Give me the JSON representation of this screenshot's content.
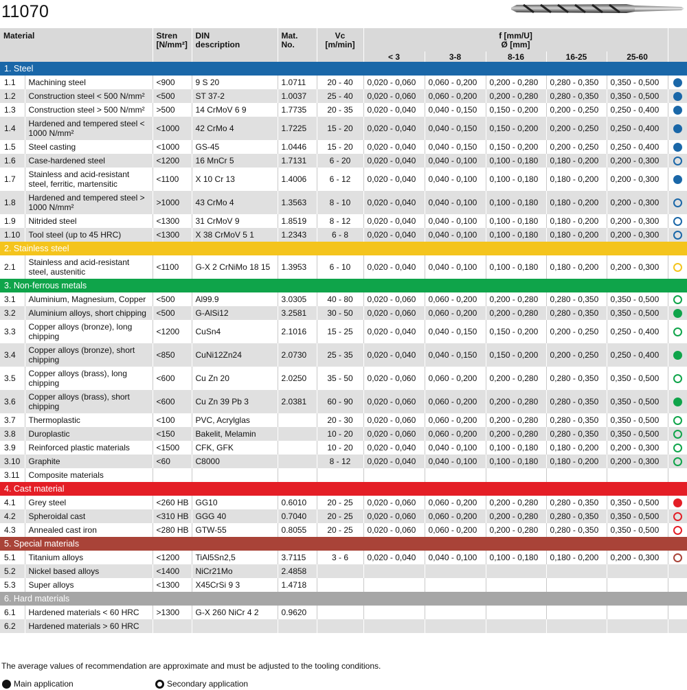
{
  "title": "11070",
  "colors": {
    "steel": "#1a67a8",
    "stainless": "#f4c41d",
    "nonferrous": "#0fa44a",
    "cast": "#e41e26",
    "special": "#a94338",
    "hard": "#a6a6a6",
    "hardmetal": "#8b8b8b"
  },
  "header": {
    "material": "Material",
    "strength_l1": "Stren",
    "strength_l2": "[N/mm²]",
    "din_l1": "DIN",
    "din_l2": "description",
    "matno_l1": "Mat.",
    "matno_l2": "No.",
    "vc_l1": "Vc",
    "vc_l2": "[m/min]",
    "f_l1": "f [mm/U]",
    "f_l2": "Ø [mm]",
    "diameters": [
      "< 3",
      "3-8",
      "8-16",
      "16-25",
      "25-60"
    ]
  },
  "sections": [
    {
      "label": "1. Steel",
      "color": "steel",
      "rows": [
        {
          "no": "1.1",
          "material": "Machining steel",
          "strength": "<900",
          "din": "9 S 20",
          "matno": "1.0711",
          "vc": "20 - 40",
          "f": [
            "0,020 - 0,060",
            "0,060 - 0,200",
            "0,200 - 0,280",
            "0,280 - 0,350",
            "0,350 - 0,500"
          ],
          "app": "main"
        },
        {
          "no": "1.2",
          "material": "Construction steel < 500 N/mm²",
          "strength": "<500",
          "din": "ST 37-2",
          "matno": "1.0037",
          "vc": "25 - 40",
          "f": [
            "0,020 - 0,060",
            "0,060 - 0,200",
            "0,200 - 0,280",
            "0,280 - 0,350",
            "0,350 - 0,500"
          ],
          "app": "main"
        },
        {
          "no": "1.3",
          "material": "Construction steel > 500 N/mm²",
          "strength": ">500",
          "din": "14 CrMoV 6 9",
          "matno": "1.7735",
          "vc": "20 - 35",
          "f": [
            "0,020 - 0,040",
            "0,040 - 0,150",
            "0,150 - 0,200",
            "0,200 - 0,250",
            "0,250 - 0,400"
          ],
          "app": "main"
        },
        {
          "no": "1.4",
          "material": "Hardened and tempered steel < 1000 N/mm²",
          "strength": "<1000",
          "din": "42 CrMo 4",
          "matno": "1.7225",
          "vc": "15 - 20",
          "f": [
            "0,020 - 0,040",
            "0,040 - 0,150",
            "0,150 - 0,200",
            "0,200 - 0,250",
            "0,250 - 0,400"
          ],
          "app": "main",
          "tall": true
        },
        {
          "no": "1.5",
          "material": "Steel casting",
          "strength": "<1000",
          "din": "GS-45",
          "matno": "1.0446",
          "vc": "15 - 20",
          "f": [
            "0,020 - 0,040",
            "0,040 - 0,150",
            "0,150 - 0,200",
            "0,200 - 0,250",
            "0,250 - 0,400"
          ],
          "app": "main"
        },
        {
          "no": "1.6",
          "material": "Case-hardened steel",
          "strength": "<1200",
          "din": "16 MnCr 5",
          "matno": "1.7131",
          "vc": "6 - 20",
          "f": [
            "0,020 - 0,040",
            "0,040 - 0,100",
            "0,100 - 0,180",
            "0,180 - 0,200",
            "0,200 - 0,300"
          ],
          "app": "secondary"
        },
        {
          "no": "1.7",
          "material": "Stainless and acid-resistant steel, ferritic, martensitic",
          "strength": "<1100",
          "din": "X 10 Cr 13",
          "matno": "1.4006",
          "vc": "6 - 12",
          "f": [
            "0,020 - 0,040",
            "0,040 - 0,100",
            "0,100 - 0,180",
            "0,180 - 0,200",
            "0,200 - 0,300"
          ],
          "app": "main",
          "tall": true
        },
        {
          "no": "1.8",
          "material": "Hardened and tempered steel > 1000 N/mm²",
          "strength": ">1000",
          "din": "43 CrMo 4",
          "matno": "1.3563",
          "vc": "8 - 10",
          "f": [
            "0,020 - 0,040",
            "0,040 - 0,100",
            "0,100 - 0,180",
            "0,180 - 0,200",
            "0,200 - 0,300"
          ],
          "app": "secondary",
          "tall": true
        },
        {
          "no": "1.9",
          "material": "Nitrided steel",
          "strength": "<1300",
          "din": "31 CrMoV 9",
          "matno": "1.8519",
          "vc": "8 - 12",
          "f": [
            "0,020 - 0,040",
            "0,040 - 0,100",
            "0,100 - 0,180",
            "0,180 - 0,200",
            "0,200 - 0,300"
          ],
          "app": "secondary"
        },
        {
          "no": "1.10",
          "material": "Tool steel (up to 45 HRC)",
          "strength": "<1300",
          "din": "X 38 CrMoV 5 1",
          "matno": "1.2343",
          "vc": "6 - 8",
          "f": [
            "0,020 - 0,040",
            "0,040 - 0,100",
            "0,100 - 0,180",
            "0,180 - 0,200",
            "0,200 - 0,300"
          ],
          "app": "secondary"
        }
      ]
    },
    {
      "label": "2. Stainless steel",
      "color": "stainless",
      "rows": [
        {
          "no": "2.1",
          "material": "Stainless and acid-resistant steel, austenitic",
          "strength": "<1100",
          "din": "G-X 2 CrNiMo 18 15",
          "matno": "1.3953",
          "vc": "6 - 10",
          "f": [
            "0,020 - 0,040",
            "0,040 - 0,100",
            "0,100 - 0,180",
            "0,180 - 0,200",
            "0,200 - 0,300"
          ],
          "app": "secondary",
          "tall": true
        }
      ]
    },
    {
      "label": "3. Non-ferrous metals",
      "color": "nonferrous",
      "rows": [
        {
          "no": "3.1",
          "material": "Aluminium, Magnesium, Copper",
          "strength": "<500",
          "din": "Al99.9",
          "matno": "3.0305",
          "vc": "40 - 80",
          "f": [
            "0,020 - 0,060",
            "0,060 - 0,200",
            "0,200 - 0,280",
            "0,280 - 0,350",
            "0,350 - 0,500"
          ],
          "app": "secondary"
        },
        {
          "no": "3.2",
          "material": "Aluminium alloys, short chipping",
          "strength": "<500",
          "din": "G-AlSi12",
          "matno": "3.2581",
          "vc": "30 - 50",
          "f": [
            "0,020 - 0,060",
            "0,060 - 0,200",
            "0,200 - 0,280",
            "0,280 - 0,350",
            "0,350 - 0,500"
          ],
          "app": "main"
        },
        {
          "no": "3.3",
          "material": "Copper alloys (bronze), long chipping",
          "strength": "<1200",
          "din": "CuSn4",
          "matno": "2.1016",
          "vc": "15 - 25",
          "f": [
            "0,020 - 0,040",
            "0,040 - 0,150",
            "0,150 - 0,200",
            "0,200 - 0,250",
            "0,250 - 0,400"
          ],
          "app": "secondary",
          "tall": true
        },
        {
          "no": "3.4",
          "material": "Copper alloys (bronze), short chipping",
          "strength": "<850",
          "din": "CuNi12Zn24",
          "matno": "2.0730",
          "vc": "25 - 35",
          "f": [
            "0,020 - 0,040",
            "0,040 - 0,150",
            "0,150 - 0,200",
            "0,200 - 0,250",
            "0,250 - 0,400"
          ],
          "app": "main",
          "tall": true
        },
        {
          "no": "3.5",
          "material": "Copper alloys (brass), long chipping",
          "strength": "<600",
          "din": "Cu Zn 20",
          "matno": "2.0250",
          "vc": "35 - 50",
          "f": [
            "0,020 - 0,060",
            "0,060 - 0,200",
            "0,200 - 0,280",
            "0,280 - 0,350",
            "0,350 - 0,500"
          ],
          "app": "secondary",
          "tall": true
        },
        {
          "no": "3.6",
          "material": "Copper alloys (brass), short chipping",
          "strength": "<600",
          "din": "Cu Zn 39 Pb 3",
          "matno": "2.0381",
          "vc": "60 - 90",
          "f": [
            "0,020 - 0,060",
            "0,060 - 0,200",
            "0,200 - 0,280",
            "0,280 - 0,350",
            "0,350 - 0,500"
          ],
          "app": "main",
          "tall": true
        },
        {
          "no": "3.7",
          "material": "Thermoplastic",
          "strength": "<100",
          "din": "PVC, Acrylglas",
          "matno": "",
          "vc": "20 - 30",
          "f": [
            "0,020 - 0,060",
            "0,060 - 0,200",
            "0,200 - 0,280",
            "0,280 - 0,350",
            "0,350 - 0,500"
          ],
          "app": "secondary"
        },
        {
          "no": "3.8",
          "material": "Duroplastic",
          "strength": "<150",
          "din": "Bakelit, Melamin",
          "matno": "",
          "vc": "10 - 20",
          "f": [
            "0,020 - 0,060",
            "0,060 - 0,200",
            "0,200 - 0,280",
            "0,280 - 0,350",
            "0,350 - 0,500"
          ],
          "app": "secondary"
        },
        {
          "no": "3.9",
          "material": "Reinforced plastic materials",
          "strength": "<1500",
          "din": "CFK, GFK",
          "matno": "",
          "vc": "10 - 20",
          "f": [
            "0,020 - 0,040",
            "0,040 - 0,100",
            "0,100 - 0,180",
            "0,180 - 0,200",
            "0,200 - 0,300"
          ],
          "app": "secondary"
        },
        {
          "no": "3.10",
          "material": "Graphite",
          "strength": "<60",
          "din": "C8000",
          "matno": "",
          "vc": "8 - 12",
          "f": [
            "0,020 - 0,040",
            "0,040 - 0,100",
            "0,100 - 0,180",
            "0,180 - 0,200",
            "0,200 - 0,300"
          ],
          "app": "secondary"
        },
        {
          "no": "3.11",
          "material": "Composite materials",
          "strength": "",
          "din": "",
          "matno": "",
          "vc": "",
          "f": [
            "",
            "",
            "",
            "",
            ""
          ],
          "app": ""
        }
      ]
    },
    {
      "label": "4. Cast material",
      "color": "cast",
      "rows": [
        {
          "no": "4.1",
          "material": "Grey steel",
          "strength": "<260 HB",
          "din": "GG10",
          "matno": "0.6010",
          "vc": "20 - 25",
          "f": [
            "0,020 - 0,060",
            "0,060 - 0,200",
            "0,200 - 0,280",
            "0,280 - 0,350",
            "0,350 - 0,500"
          ],
          "app": "main"
        },
        {
          "no": "4.2",
          "material": "Spheroidal cast",
          "strength": "<310 HB",
          "din": "GGG 40",
          "matno": "0.7040",
          "vc": "20 - 25",
          "f": [
            "0,020 - 0,060",
            "0,060 - 0,200",
            "0,200 - 0,280",
            "0,280 - 0,350",
            "0,350 - 0,500"
          ],
          "app": "secondary"
        },
        {
          "no": "4.3",
          "material": "Annealed cast iron",
          "strength": "<280 HB",
          "din": "GTW-55",
          "matno": "0.8055",
          "vc": "20 - 25",
          "f": [
            "0,020 - 0,060",
            "0,060 - 0,200",
            "0,200 - 0,280",
            "0,280 - 0,350",
            "0,350 - 0,500"
          ],
          "app": "secondary"
        }
      ]
    },
    {
      "label": "5. Special materials",
      "color": "special",
      "rows": [
        {
          "no": "5.1",
          "material": "Titanium alloys",
          "strength": "<1200",
          "din": "TiAl5Sn2,5",
          "matno": "3.7115",
          "vc": "3 - 6",
          "f": [
            "0,020 - 0,040",
            "0,040 - 0,100",
            "0,100 - 0,180",
            "0,180 - 0,200",
            "0,200 - 0,300"
          ],
          "app": "secondary"
        },
        {
          "no": "5.2",
          "material": "Nickel based alloys",
          "strength": "<1400",
          "din": "NiCr21Mo",
          "matno": "2.4858",
          "vc": "",
          "f": [
            "",
            "",
            "",
            "",
            ""
          ],
          "app": ""
        },
        {
          "no": "5.3",
          "material": "Super alloys",
          "strength": "<1300",
          "din": "X45CrSi 9 3",
          "matno": "1.4718",
          "vc": "",
          "f": [
            "",
            "",
            "",
            "",
            ""
          ],
          "app": ""
        }
      ]
    },
    {
      "label": "6. Hard materials",
      "color": "hard",
      "rows": [
        {
          "no": "6.1",
          "material": "Hardened materials < 60 HRC",
          "strength": ">1300",
          "din": "G-X 260 NiCr 4 2",
          "matno": "0.9620",
          "vc": "",
          "f": [
            "",
            "",
            "",
            "",
            ""
          ],
          "app": ""
        },
        {
          "no": "6.2",
          "material": "Hardened materials > 60 HRC",
          "strength": "",
          "din": "",
          "matno": "",
          "vc": "",
          "f": [
            "",
            "",
            "",
            "",
            ""
          ],
          "app": ""
        }
      ]
    }
  ],
  "footer": {
    "note": "The average values of recommendation are approximate and must be adjusted to the tooling conditions.",
    "legend_main": "Main application",
    "legend_secondary": "Secondary application"
  }
}
